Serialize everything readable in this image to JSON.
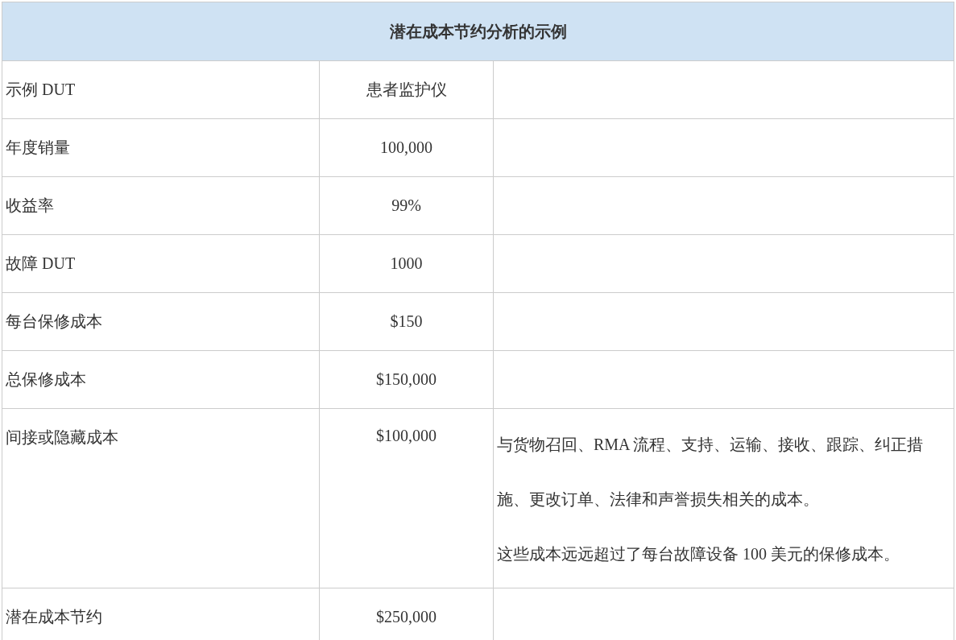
{
  "table": {
    "title": "潜在成本节约分析的示例",
    "rows": [
      {
        "label": "示例 DUT",
        "value": "患者监护仪"
      },
      {
        "label": "年度销量",
        "value": "100,000"
      },
      {
        "label": "收益率",
        "value": "99%"
      },
      {
        "label": "故障 DUT",
        "value": "1000"
      },
      {
        "label": "每台保修成本",
        "value": "$150"
      },
      {
        "label": "总保修成本",
        "value": "$150,000"
      },
      {
        "label": "间接或隐藏成本",
        "value": "$100,000",
        "notes": [
          "与货物召回、RMA 流程、支持、运输、接收、跟踪、纠正措施、更改订单、法律和声誉损失相关的成本。",
          "这些成本远远超过了每台故障设备 100 美元的保修成本。"
        ]
      },
      {
        "label": "潜在成本节约",
        "value": "$250,000"
      }
    ]
  }
}
